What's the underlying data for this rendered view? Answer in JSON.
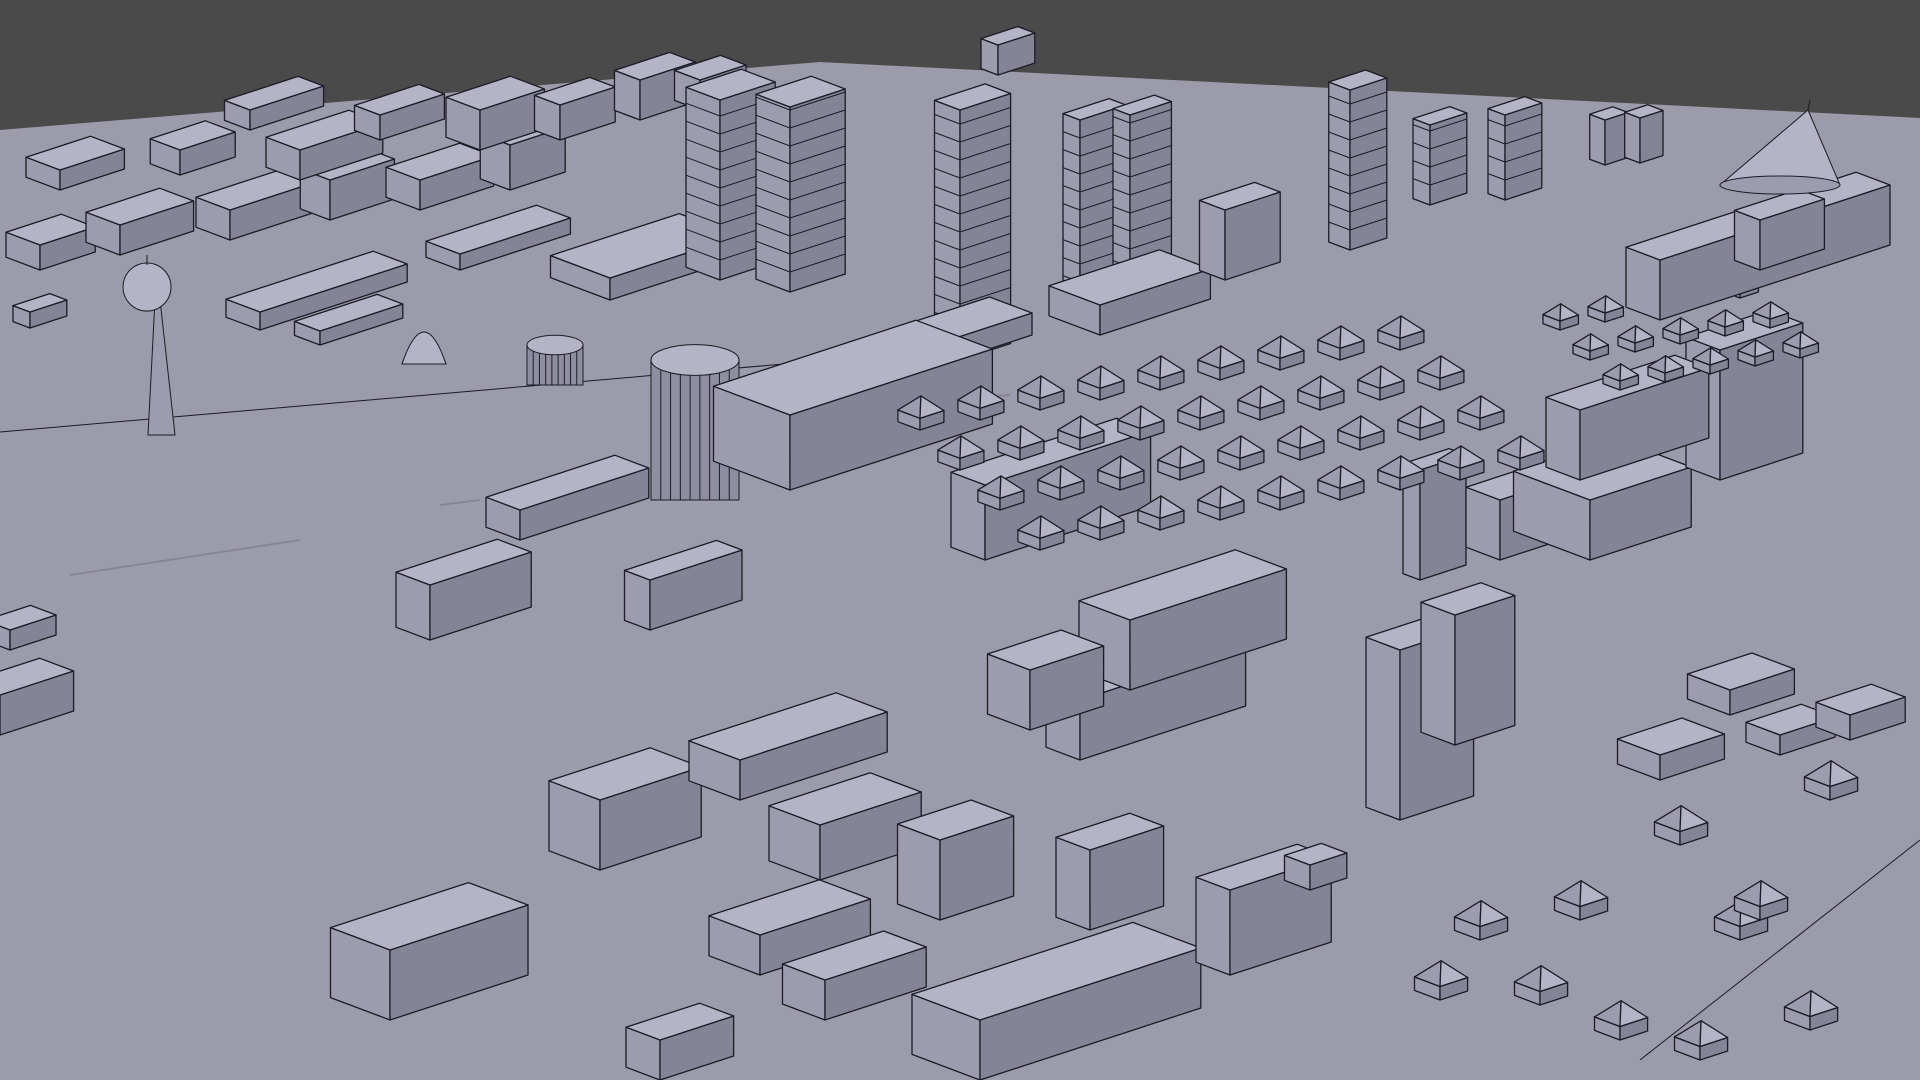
{
  "app": {
    "name": "3D viewport"
  },
  "viewport": {
    "view": "perspective",
    "shading": "solid",
    "wire_overlay": true
  },
  "colors": {
    "background": "#4a4a4a",
    "ground": "#9c9ba9",
    "building_top": "#b5b4c6",
    "building_left": "#9d9caf",
    "building_right": "#858497",
    "edge": "#1c1c26"
  },
  "scene": {
    "subject": "city-block-model",
    "landmarks": [
      "tower-with-sphere",
      "glass-dome",
      "cone-tent-structure",
      "twin-towers",
      "curved-towers"
    ]
  }
}
